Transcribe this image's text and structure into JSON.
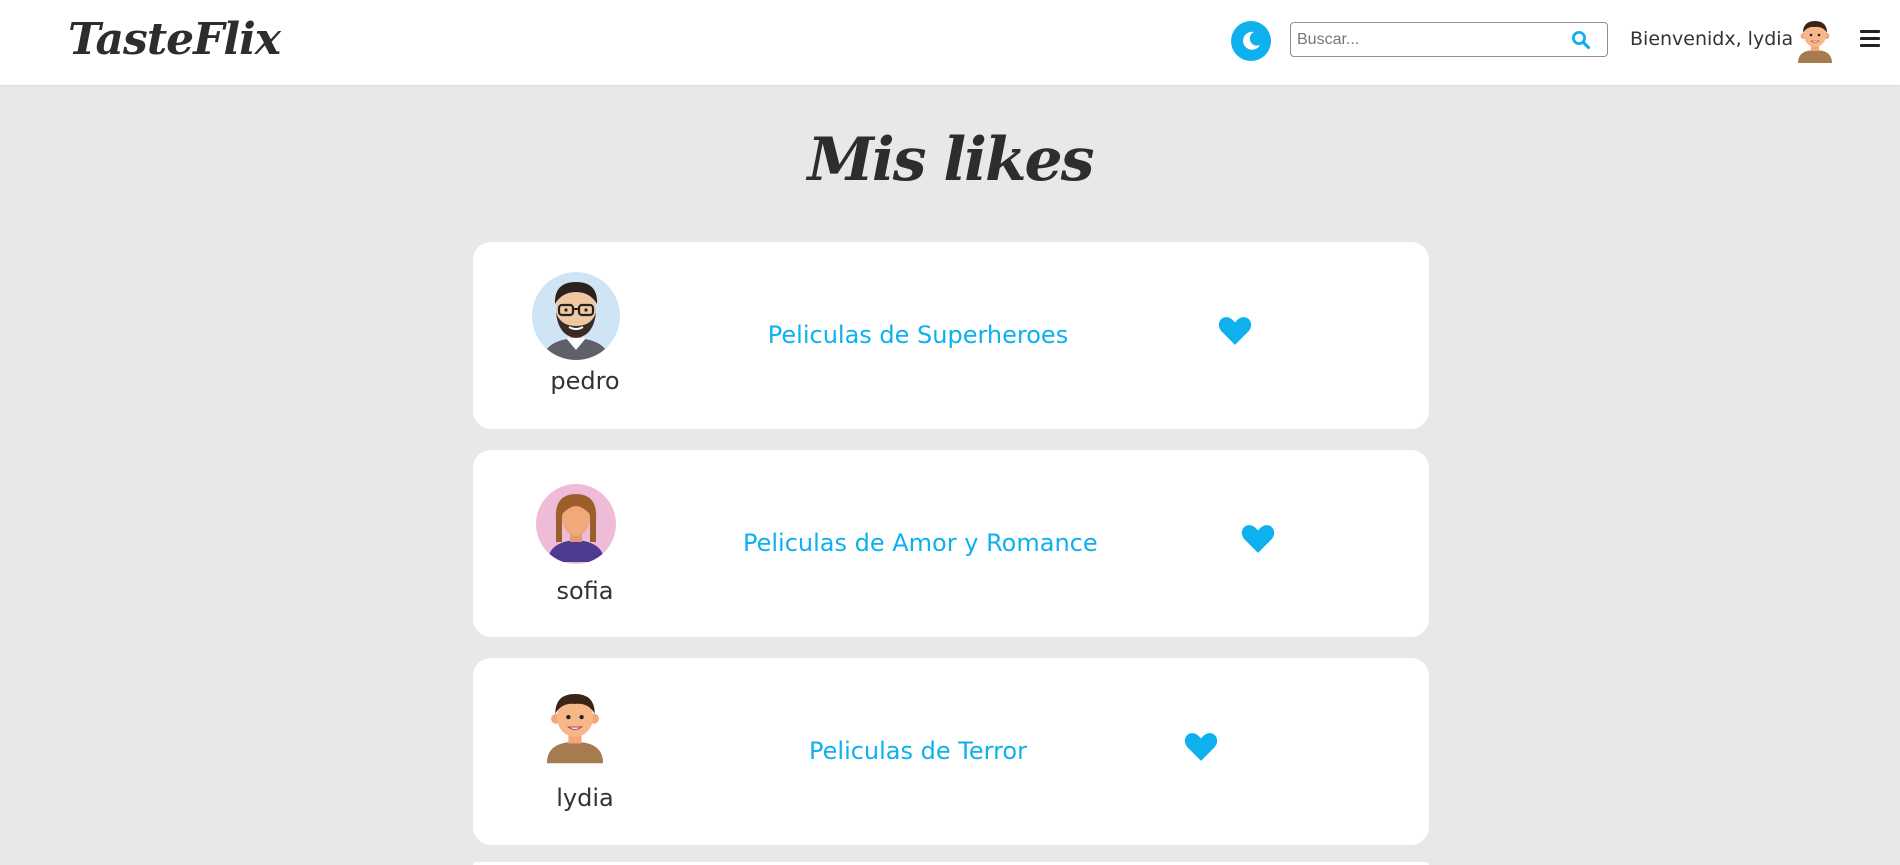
{
  "header": {
    "logo": "TasteFlix",
    "theme_toggle_icon": "moon-icon",
    "search": {
      "placeholder": "Buscar...",
      "value": "",
      "icon": "search-icon"
    },
    "welcome_text": "Bienvenidx, lydia",
    "menu_icon": "hamburger-menu-icon"
  },
  "page": {
    "title": "Mis likes"
  },
  "likes": [
    {
      "user": "pedro",
      "list_title": "Peliculas de Superheroes",
      "icon": "heart-icon"
    },
    {
      "user": "sofia",
      "list_title": "Peliculas de Amor y Romance",
      "icon": "heart-icon"
    },
    {
      "user": "lydia",
      "list_title": "Peliculas de Terror",
      "icon": "heart-icon"
    }
  ],
  "colors": {
    "accent": "#0eb0ed",
    "background": "#e8e8e8",
    "card": "#ffffff",
    "text": "#333333"
  }
}
